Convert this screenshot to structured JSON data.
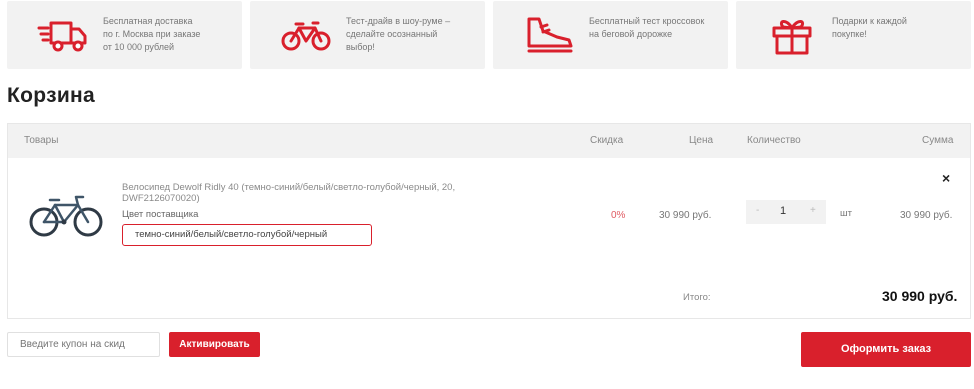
{
  "features": [
    {
      "icon": "delivery-truck-icon",
      "text_lines": [
        "Бесплатная доставка",
        "по г. Москва при заказе",
        "от 10 000 рублей"
      ]
    },
    {
      "icon": "bicycle-icon",
      "text_lines": [
        "Тест-драйв в шоу-руме –",
        "сделайте осознанный",
        "выбор!"
      ]
    },
    {
      "icon": "sneaker-icon",
      "text_lines": [
        "Бесплатный тест кроссовок",
        "на беговой дорожке"
      ]
    },
    {
      "icon": "gift-icon",
      "text_lines": [
        "Подарки к каждой",
        "покупке!"
      ]
    }
  ],
  "page_title": "Корзина",
  "cart": {
    "headers": {
      "goods": "Товары",
      "discount": "Скидка",
      "price": "Цена",
      "quantity": "Количество",
      "sum": "Сумма"
    },
    "item": {
      "name_line1": "Велосипед Dewolf Ridly 40 (темно-синий/белый/светло-голубой/черный, 20,",
      "name_line2": "DWF2126070020)",
      "color_label": "Цвет поставщика",
      "color_value": "темно-синий/белый/светло-голубой/черный",
      "discount": "0%",
      "price": "30 990 руб.",
      "qty_minus": "-",
      "qty": "1",
      "qty_plus": "+",
      "unit": "шт",
      "sum": "30 990 руб.",
      "remove": "×"
    },
    "total_label": "Итого:",
    "total_value": "30 990 руб."
  },
  "coupon": {
    "placeholder": "Введите купон на скид",
    "button": "Активировать"
  },
  "checkout_button": "Оформить заказ",
  "colors": {
    "accent": "#d9202c",
    "card_bg": "#f2f2f2"
  }
}
